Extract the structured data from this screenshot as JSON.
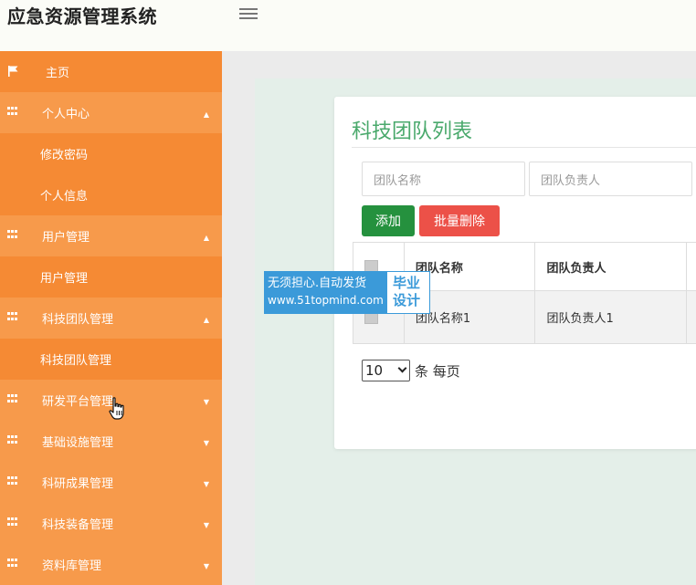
{
  "header": {
    "app_title": "应急资源管理系统"
  },
  "sidebar": {
    "items": [
      {
        "label": "主页",
        "type": "home"
      },
      {
        "label": "个人中心",
        "type": "parent",
        "arrow": "up"
      },
      {
        "label": "修改密码",
        "type": "sub"
      },
      {
        "label": "个人信息",
        "type": "sub"
      },
      {
        "label": "用户管理",
        "type": "parent",
        "arrow": "up"
      },
      {
        "label": "用户管理",
        "type": "sub"
      },
      {
        "label": "科技团队管理",
        "type": "parent",
        "arrow": "up"
      },
      {
        "label": "科技团队管理",
        "type": "sub"
      },
      {
        "label": "研发平台管理",
        "type": "parent",
        "arrow": "down"
      },
      {
        "label": "基础设施管理",
        "type": "parent",
        "arrow": "down"
      },
      {
        "label": "科研成果管理",
        "type": "parent",
        "arrow": "down"
      },
      {
        "label": "科技装备管理",
        "type": "parent",
        "arrow": "down"
      },
      {
        "label": "资料库管理",
        "type": "parent",
        "arrow": "down"
      }
    ]
  },
  "card": {
    "title": "科技团队列表",
    "search": {
      "team_name_placeholder": "团队名称",
      "leader_placeholder": "团队负责人"
    },
    "buttons": {
      "add_label": "添加",
      "batch_delete_label": "批量删除"
    },
    "table": {
      "headers": [
        "团队名称",
        "团队负责人"
      ],
      "rows": [
        [
          "团队名称1",
          "团队负责人1"
        ]
      ]
    },
    "pagination": {
      "page_size": "10",
      "per_page_label": "条 每页"
    }
  },
  "watermark": {
    "line1": "无须担心.自动发货",
    "line2": "www.51topmind.com",
    "badge_line1": "毕业",
    "badge_line2": "设计"
  },
  "colors": {
    "sidebar": "#f58a34",
    "sidebar_parent": "#f79a4b",
    "title_green": "#4aa96c",
    "add_button": "#25913e",
    "delete_button": "#ec5148"
  }
}
